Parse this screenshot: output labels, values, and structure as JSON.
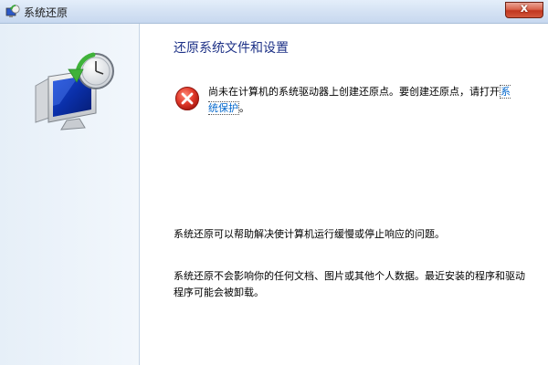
{
  "window": {
    "title": "系统还原",
    "close_label": "x"
  },
  "icons": {
    "app": "system-restore-icon",
    "graphic": "system-restore-clock-monitor-icon",
    "error": "error-icon"
  },
  "colors": {
    "title_color": "#1e3287",
    "link_color": "#0066cc",
    "error_red": "#d8362a",
    "close_red": "#c1361f"
  },
  "main": {
    "heading": "还原系统文件和设置",
    "error_text": "尚未在计算机的系统驱动器上创建还原点。要创建还原点，请打开",
    "link_text": "系统保护",
    "error_suffix": "。",
    "info_1": "系统还原可以帮助解决使计算机运行缓慢或停止响应的问题。",
    "info_2": "系统还原不会影响你的任何文档、图片或其他个人数据。最近安装的程序和驱动程序可能会被卸载。"
  }
}
